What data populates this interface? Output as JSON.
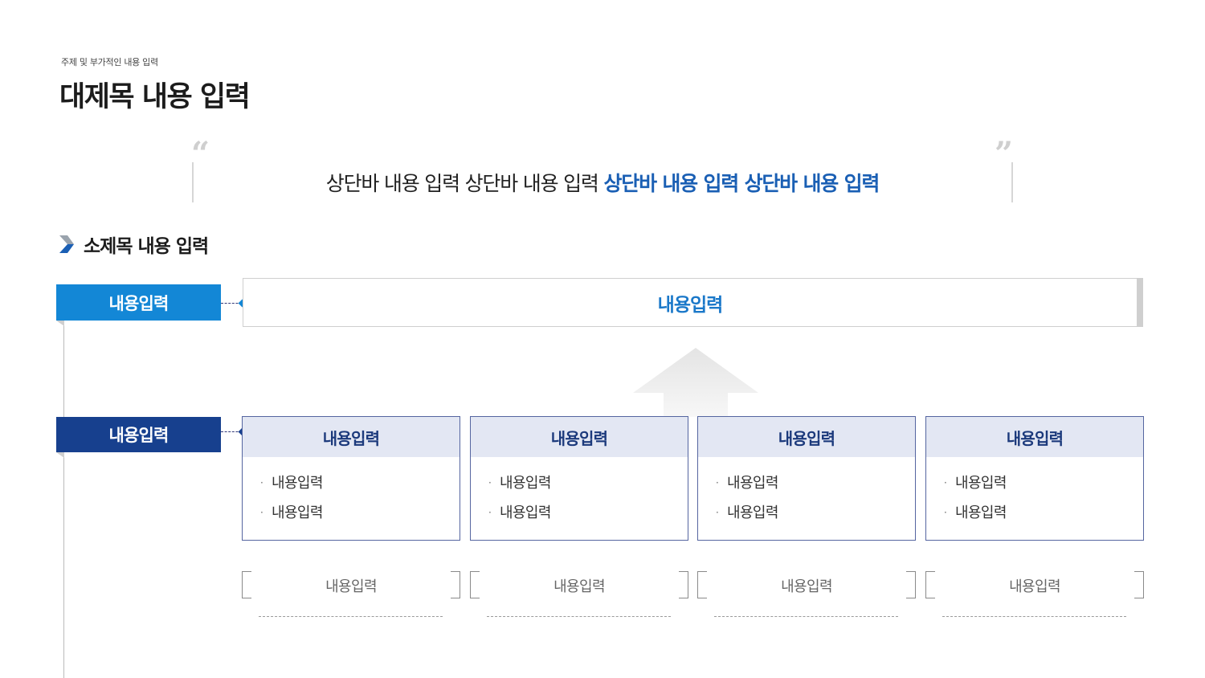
{
  "header": {
    "eyebrow": "주제 및 부가적인 내용 입력",
    "title": "대제목 내용 입력"
  },
  "quote": {
    "open_mark": "“",
    "close_mark": "”",
    "text_normal": "상단바 내용 입력 상단바 내용 입력 ",
    "text_highlight": "상단바 내용 입력 상단바 내용 입력"
  },
  "subtitle": {
    "icon": "chevron-right-icon",
    "text": "소제목 내용 입력"
  },
  "tags": {
    "upper": "내용입력",
    "lower": "내용입력"
  },
  "top_box": {
    "text": "내용입력"
  },
  "cards": [
    {
      "title": "내용입력",
      "items": [
        "내용입력",
        "내용입력"
      ],
      "caption": "내용입력"
    },
    {
      "title": "내용입력",
      "items": [
        "내용입력",
        "내용입력"
      ],
      "caption": "내용입력"
    },
    {
      "title": "내용입력",
      "items": [
        "내용입력",
        "내용입력"
      ],
      "caption": "내용입력"
    },
    {
      "title": "내용입력",
      "items": [
        "내용입력",
        "내용입력"
      ],
      "caption": "내용입력"
    }
  ],
  "colors": {
    "accent_light": "#1387d6",
    "accent_dark": "#17408e",
    "highlight_text": "#1a5fb4",
    "card_header_bg": "#e3e7f3"
  }
}
